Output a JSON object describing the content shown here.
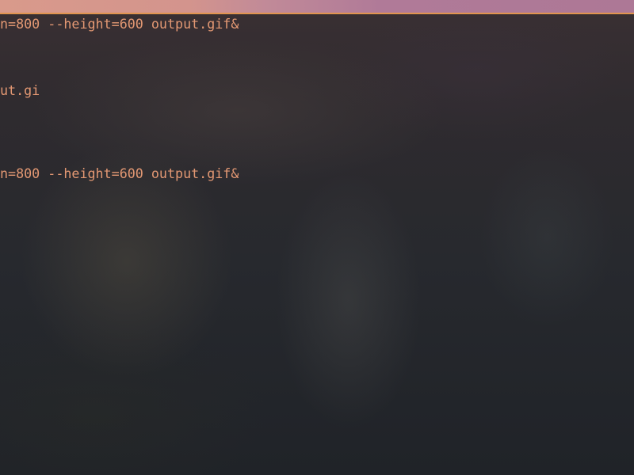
{
  "terminal": {
    "lines": [
      "n=800 --height=600 output.gif&",
      "ut.gi",
      "n=800 --height=600 output.gif&"
    ]
  },
  "colors": {
    "text": "#e39873",
    "background": "#25272c",
    "top_bar": "#c18a98",
    "top_bar_border": "#e0944f"
  }
}
